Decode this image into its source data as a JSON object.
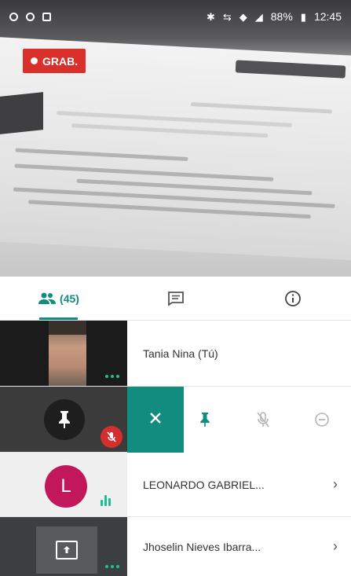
{
  "status_bar": {
    "battery": "88%",
    "time": "12:45"
  },
  "video": {
    "recording_label": "GRAB."
  },
  "tabs": {
    "participants_count": "(45)"
  },
  "participants": [
    {
      "name": "Tania Nina (Tú)"
    },
    {
      "name": ""
    },
    {
      "name": "LEONARDO GABRIEL...",
      "avatar_letter": "L",
      "avatar_color": "#c2185b"
    },
    {
      "name": "Jhoselin Nieves Ibarra..."
    }
  ],
  "colors": {
    "accent": "#128c7e",
    "recording": "#d9302b",
    "muted": "#d32f2f",
    "speaking": "#1fbf94"
  },
  "icons": {
    "participants_tab": "people-icon",
    "chat_tab": "chat-icon",
    "info_tab": "info-icon",
    "row_actions": [
      "close-icon",
      "pin-icon",
      "mic-off-icon",
      "remove-icon"
    ]
  }
}
